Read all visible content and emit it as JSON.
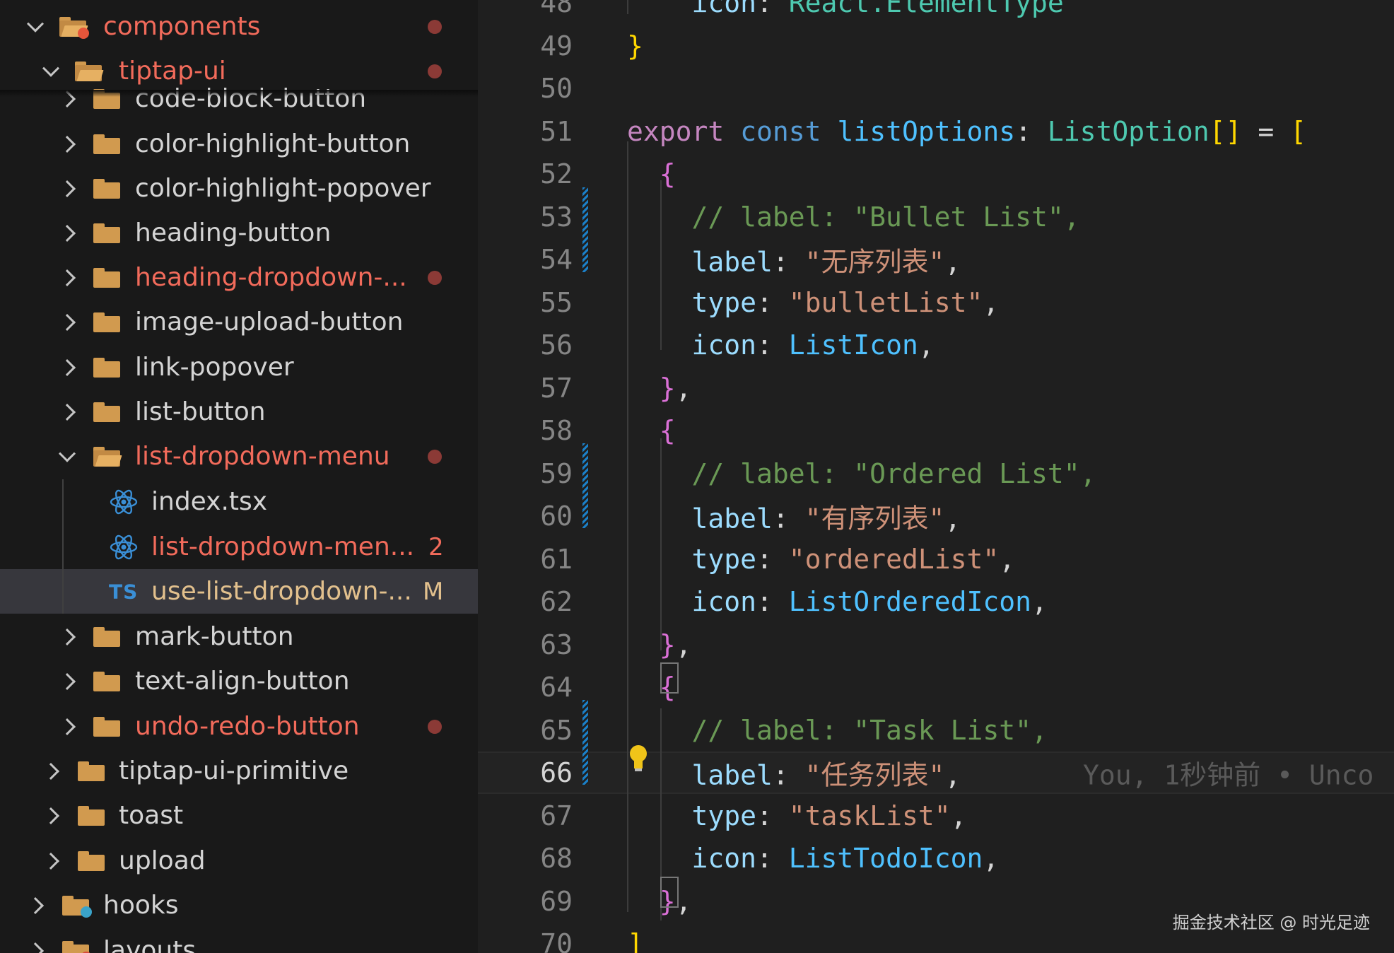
{
  "explorer": {
    "items": [
      {
        "label": "components",
        "kind": "folder-special",
        "expanded": true,
        "status": "dot"
      },
      {
        "label": "tiptap-ui",
        "kind": "folder",
        "expanded": true,
        "status": "dot"
      },
      {
        "label": "code-block-button",
        "kind": "folder",
        "expanded": false,
        "status": ""
      },
      {
        "label": "color-highlight-button",
        "kind": "folder",
        "expanded": false,
        "status": ""
      },
      {
        "label": "color-highlight-popover",
        "kind": "folder",
        "expanded": false,
        "status": ""
      },
      {
        "label": "heading-button",
        "kind": "folder",
        "expanded": false,
        "status": ""
      },
      {
        "label": "heading-dropdown-...",
        "kind": "folder",
        "expanded": false,
        "status": "dot"
      },
      {
        "label": "image-upload-button",
        "kind": "folder",
        "expanded": false,
        "status": ""
      },
      {
        "label": "link-popover",
        "kind": "folder",
        "expanded": false,
        "status": ""
      },
      {
        "label": "list-button",
        "kind": "folder",
        "expanded": false,
        "status": ""
      },
      {
        "label": "list-dropdown-menu",
        "kind": "folder",
        "expanded": true,
        "status": "dot"
      },
      {
        "label": "index.tsx",
        "kind": "react-file",
        "status": ""
      },
      {
        "label": "list-dropdown-men...",
        "kind": "react-file",
        "status": "count",
        "count": "2"
      },
      {
        "label": "use-list-dropdown-...",
        "kind": "ts-file",
        "status": "M",
        "selected": true
      },
      {
        "label": "mark-button",
        "kind": "folder",
        "expanded": false,
        "status": ""
      },
      {
        "label": "text-align-button",
        "kind": "folder",
        "expanded": false,
        "status": ""
      },
      {
        "label": "undo-redo-button",
        "kind": "folder",
        "expanded": false,
        "status": "dot"
      },
      {
        "label": "tiptap-ui-primitive",
        "kind": "folder",
        "expanded": false,
        "status": ""
      },
      {
        "label": "toast",
        "kind": "folder",
        "expanded": false,
        "status": ""
      },
      {
        "label": "upload",
        "kind": "folder",
        "expanded": false,
        "status": ""
      },
      {
        "label": "hooks",
        "kind": "folder-hooks",
        "expanded": false,
        "status": ""
      },
      {
        "label": "layouts",
        "kind": "folder-layouts",
        "expanded": false,
        "status": ""
      }
    ],
    "ts_icon_text": "TS",
    "m_badge": "M"
  },
  "editor": {
    "lines": [
      {
        "n": "48",
        "tokens": [
          [
            "prop",
            "    icon"
          ],
          [
            "punct",
            ": "
          ],
          [
            "type",
            "React.ElementType"
          ]
        ]
      },
      {
        "n": "49",
        "tokens": [
          [
            "brace1",
            "}"
          ]
        ]
      },
      {
        "n": "50",
        "tokens": []
      },
      {
        "n": "51",
        "tokens": [
          [
            "kw",
            "export"
          ],
          [
            "punct",
            " "
          ],
          [
            "const",
            "const"
          ],
          [
            "punct",
            " "
          ],
          [
            "var",
            "listOptions"
          ],
          [
            "punct",
            ": "
          ],
          [
            "type",
            "ListOption"
          ],
          [
            "brace1",
            "[]"
          ],
          [
            "punct",
            " = "
          ],
          [
            "brace1",
            "["
          ]
        ]
      },
      {
        "n": "52",
        "tokens": [
          [
            "punct",
            "  "
          ],
          [
            "brace2",
            "{"
          ]
        ]
      },
      {
        "n": "53",
        "tokens": [
          [
            "punct",
            "    "
          ],
          [
            "comment",
            "// label: \"Bullet List\","
          ]
        ]
      },
      {
        "n": "54",
        "tokens": [
          [
            "punct",
            "    "
          ],
          [
            "prop",
            "label"
          ],
          [
            "punct",
            ": "
          ],
          [
            "str",
            "\"无序列表\""
          ],
          [
            "punct",
            ","
          ]
        ]
      },
      {
        "n": "55",
        "tokens": [
          [
            "punct",
            "    "
          ],
          [
            "prop",
            "type"
          ],
          [
            "punct",
            ": "
          ],
          [
            "str",
            "\"bulletList\""
          ],
          [
            "punct",
            ","
          ]
        ]
      },
      {
        "n": "56",
        "tokens": [
          [
            "punct",
            "    "
          ],
          [
            "prop",
            "icon"
          ],
          [
            "punct",
            ": "
          ],
          [
            "var",
            "ListIcon"
          ],
          [
            "punct",
            ","
          ]
        ]
      },
      {
        "n": "57",
        "tokens": [
          [
            "punct",
            "  "
          ],
          [
            "brace2",
            "}"
          ],
          [
            "punct",
            ","
          ]
        ]
      },
      {
        "n": "58",
        "tokens": [
          [
            "punct",
            "  "
          ],
          [
            "brace2",
            "{"
          ]
        ]
      },
      {
        "n": "59",
        "tokens": [
          [
            "punct",
            "    "
          ],
          [
            "comment",
            "// label: \"Ordered List\","
          ]
        ]
      },
      {
        "n": "60",
        "tokens": [
          [
            "punct",
            "    "
          ],
          [
            "prop",
            "label"
          ],
          [
            "punct",
            ": "
          ],
          [
            "str",
            "\"有序列表\""
          ],
          [
            "punct",
            ","
          ]
        ]
      },
      {
        "n": "61",
        "tokens": [
          [
            "punct",
            "    "
          ],
          [
            "prop",
            "type"
          ],
          [
            "punct",
            ": "
          ],
          [
            "str",
            "\"orderedList\""
          ],
          [
            "punct",
            ","
          ]
        ]
      },
      {
        "n": "62",
        "tokens": [
          [
            "punct",
            "    "
          ],
          [
            "prop",
            "icon"
          ],
          [
            "punct",
            ": "
          ],
          [
            "var",
            "ListOrderedIcon"
          ],
          [
            "punct",
            ","
          ]
        ]
      },
      {
        "n": "63",
        "tokens": [
          [
            "punct",
            "  "
          ],
          [
            "brace2",
            "}"
          ],
          [
            "punct",
            ","
          ]
        ]
      },
      {
        "n": "64",
        "tokens": [
          [
            "punct",
            "  "
          ],
          [
            "brace2",
            "{"
          ]
        ]
      },
      {
        "n": "65",
        "tokens": [
          [
            "punct",
            "    "
          ],
          [
            "comment",
            "// label: \"Task List\","
          ]
        ]
      },
      {
        "n": "66",
        "tokens": [
          [
            "punct",
            "    "
          ],
          [
            "prop",
            "label"
          ],
          [
            "punct",
            ": "
          ],
          [
            "str",
            "\"任务列表\""
          ],
          [
            "punct",
            ","
          ]
        ],
        "current": true
      },
      {
        "n": "67",
        "tokens": [
          [
            "punct",
            "    "
          ],
          [
            "prop",
            "type"
          ],
          [
            "punct",
            ": "
          ],
          [
            "str",
            "\"taskList\""
          ],
          [
            "punct",
            ","
          ]
        ]
      },
      {
        "n": "68",
        "tokens": [
          [
            "punct",
            "    "
          ],
          [
            "prop",
            "icon"
          ],
          [
            "punct",
            ": "
          ],
          [
            "var",
            "ListTodoIcon"
          ],
          [
            "punct",
            ","
          ]
        ]
      },
      {
        "n": "69",
        "tokens": [
          [
            "punct",
            "  "
          ],
          [
            "brace2",
            "}"
          ],
          [
            "punct",
            ","
          ]
        ]
      },
      {
        "n": "70",
        "tokens": [
          [
            "brace1",
            "]"
          ]
        ]
      }
    ],
    "blame": "You, 1秒钟前 • Unco"
  },
  "watermark": "掘金技术社区 @ 时光足迹",
  "colors": {
    "modified_text": "#f26b5b",
    "modified_m": "#e2c08d",
    "folder": "#d19a4f",
    "react_blue": "#3a8fd6",
    "gutter_modified": "#1b80c8"
  }
}
